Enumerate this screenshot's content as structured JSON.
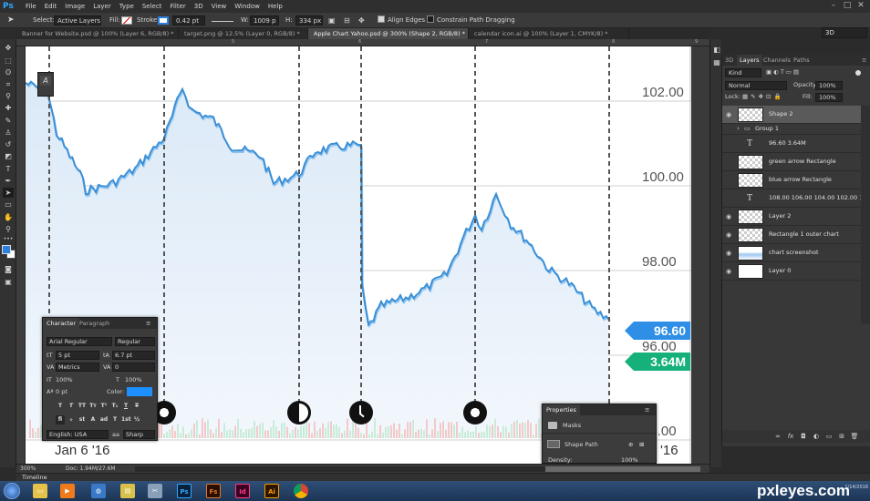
{
  "app": {
    "logo": "Ps",
    "menu": [
      "File",
      "Edit",
      "Image",
      "Layer",
      "Type",
      "Select",
      "Filter",
      "3D",
      "View",
      "Window",
      "Help"
    ],
    "window_controls": [
      "–",
      "□",
      "✕"
    ]
  },
  "options": {
    "select_label": "Select:",
    "select_value": "Active Layers",
    "fill_label": "Fill:",
    "stroke_label": "Stroke:",
    "stroke_size": "0.42 pt",
    "w_label": "W:",
    "w_value": "1009 p",
    "h_label": "H:",
    "h_value": "334 px",
    "align_edges": "Align Edges",
    "constrain": "Constrain Path Dragging",
    "workspace": "3D"
  },
  "tabs": [
    "Banner for Website.psd @ 100% (Layer 6, RGB/8) *",
    "target.png @ 12.5% (Layer 0, RGB/8) *",
    "Apple Chart Yahoo.psd @ 300% (Shape 2, RGB/8) *",
    "calendar icon.ai @ 100% (Layer 1, CMYK/8) *"
  ],
  "ruler": [
    "5",
    "6",
    "7",
    "8",
    "9"
  ],
  "chart": {
    "prices": [
      "102.00",
      "100.00",
      "98.00",
      "96.00",
      "94.00"
    ],
    "start_date": "Jan 6 '16",
    "end_date": "'16",
    "price_tag": "96.60",
    "volume_tag": "3.64M",
    "price_tag_color": "#2f8fe6",
    "volume_tag_color": "#16b07a",
    "line_color": "#3a8fd6"
  },
  "character_panel": {
    "tabs": [
      "Character",
      "Paragraph"
    ],
    "font": "Arial Regular",
    "style": "Regular",
    "size": "5 pt",
    "leading": "6.7 pt",
    "kerning": "Metrics",
    "tracking": "0",
    "vscale": "100%",
    "hscale": "100%",
    "baseline": "0 pt",
    "color_label": "Color:",
    "color": "#1e90ff",
    "style_buttons": [
      "T",
      "T",
      "TT",
      "Tт",
      "T¹",
      "T₁",
      "T",
      "T"
    ],
    "ot_buttons": [
      "fi",
      "ℴ",
      "st",
      "A",
      "ad",
      "T",
      "1st",
      "½"
    ],
    "language": "English: USA",
    "aa_label": "aa",
    "antialias": "Sharp"
  },
  "properties_panel": {
    "title": "Properties",
    "masks_label": "Masks",
    "shape_path": "Shape Path",
    "density_label": "Density:",
    "density": "100%"
  },
  "layers_panel": {
    "tabs": [
      "3D",
      "Layers",
      "Channels",
      "Paths"
    ],
    "kind_label": "Kind",
    "blend_mode": "Normal",
    "opacity_label": "Opacity:",
    "opacity": "100%",
    "lock_label": "Lock:",
    "fill_label": "Fill:",
    "fill": "100%",
    "layers": [
      {
        "name": "Shape 2",
        "type": "shape"
      },
      {
        "name": "Group 1",
        "type": "group"
      },
      {
        "name": "96.60 3.64M",
        "type": "text"
      },
      {
        "name": "green arrow Rectangle",
        "type": "shape"
      },
      {
        "name": "blue arrow Rectangle",
        "type": "shape"
      },
      {
        "name": "108.00 106.00 104.00 102.00 1...",
        "type": "text"
      },
      {
        "name": "Layer 2",
        "type": "pixel"
      },
      {
        "name": "Rectangle 1 outer chart",
        "type": "shape"
      },
      {
        "name": "chart screenshot",
        "type": "pixel"
      },
      {
        "name": "Layer 0",
        "type": "pixel"
      }
    ],
    "footer_icons": [
      "∞",
      "fx",
      "◘",
      "◐",
      "▭",
      "⊞",
      "🗑"
    ]
  },
  "status": {
    "zoom": "300%",
    "doc": "Doc: 1.94M/27.6M"
  },
  "timeline": "Timeline",
  "taskbar": {
    "apps": [
      "Ps",
      "Fs",
      "Id",
      "Ai"
    ],
    "watermark": "pxleyes.com",
    "clock": "1/14/2016"
  }
}
